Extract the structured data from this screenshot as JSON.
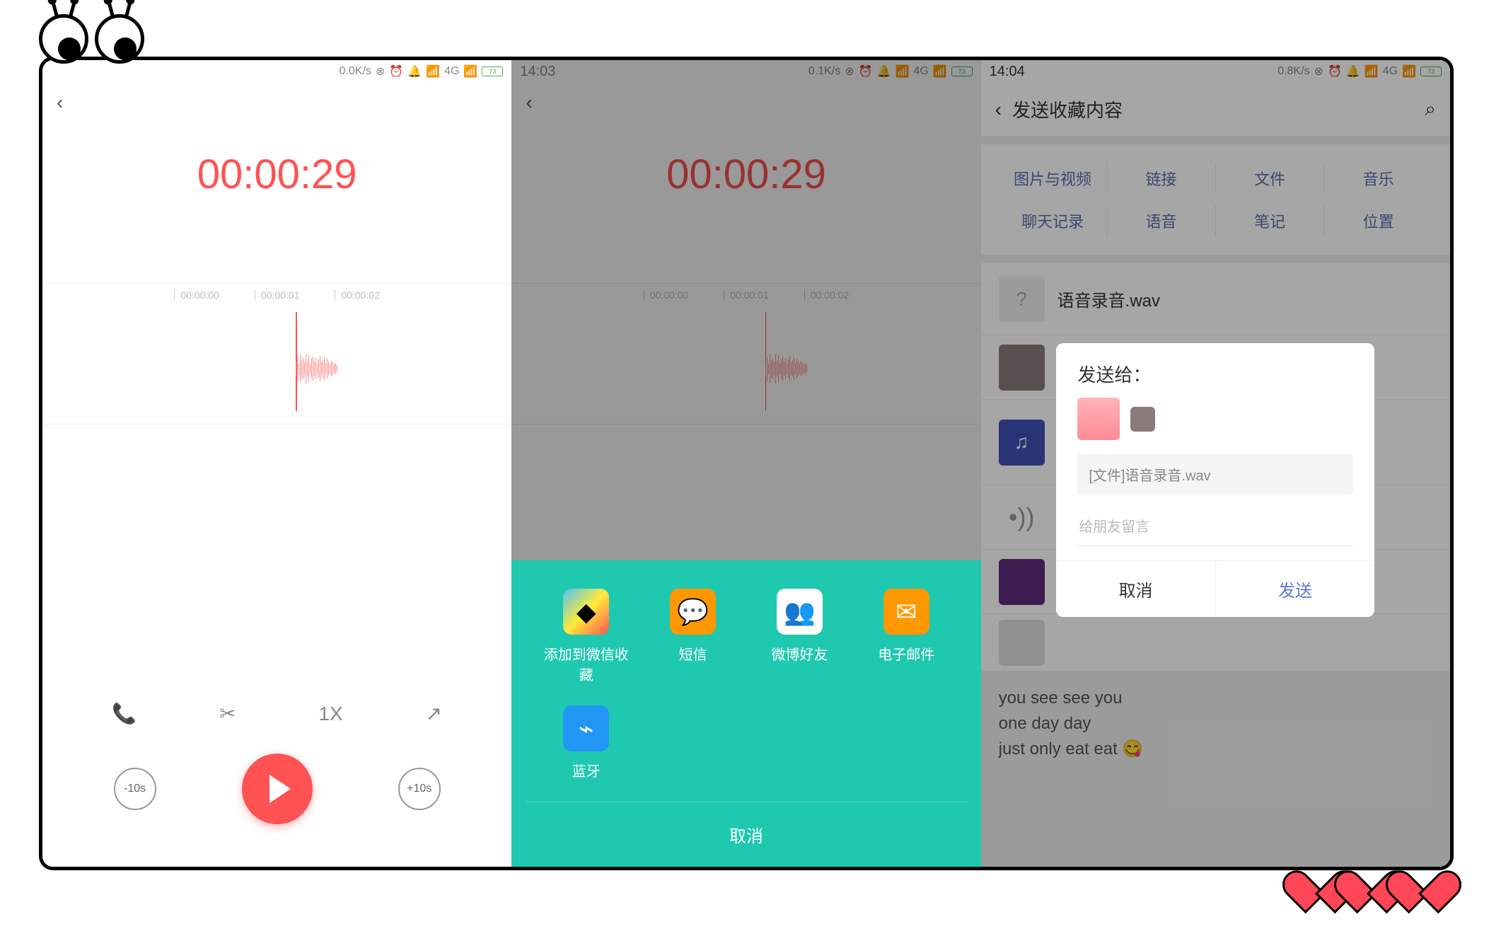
{
  "status": {
    "s1": {
      "speed": "0.0K/s",
      "net": "4G",
      "battery": "73"
    },
    "s2": {
      "time": "14:03",
      "speed": "0.1K/s",
      "net": "4G",
      "battery": "73"
    },
    "s3": {
      "time": "14:04",
      "speed": "0.8K/s",
      "net": "4G",
      "battery": "73"
    }
  },
  "screen1": {
    "timer": "00:00:29",
    "ticks": [
      "00:00:00",
      "00:00:01",
      "00:00:02"
    ],
    "speed_label": "1X",
    "skip_back": "-10s",
    "skip_fwd": "+10s"
  },
  "screen2": {
    "timer": "00:00:29",
    "ticks": [
      "00:00:00",
      "00:00:01",
      "00:00:02"
    ],
    "share_items": [
      {
        "label": "添加到微信收藏",
        "icon": "cube"
      },
      {
        "label": "短信",
        "icon": "chat"
      },
      {
        "label": "微博好友",
        "icon": "people"
      },
      {
        "label": "电子邮件",
        "icon": "mail"
      },
      {
        "label": "蓝牙",
        "icon": "bluetooth"
      }
    ],
    "cancel": "取消"
  },
  "screen3": {
    "nav_title": "发送收藏内容",
    "filters_row1": [
      "图片与视频",
      "链接",
      "文件",
      "音乐"
    ],
    "filters_row2": [
      "聊天记录",
      "语音",
      "笔记",
      "位置"
    ],
    "items": [
      {
        "title": "语音录音.wav",
        "icon": "?"
      }
    ],
    "bottom_lines": [
      "you see see you",
      "one day day",
      "just only eat eat 😋"
    ],
    "dialog": {
      "title": "发送给：",
      "file_label": "[文件]语音录音.wav",
      "placeholder": "给朋友留言",
      "cancel": "取消",
      "send": "发送"
    }
  }
}
